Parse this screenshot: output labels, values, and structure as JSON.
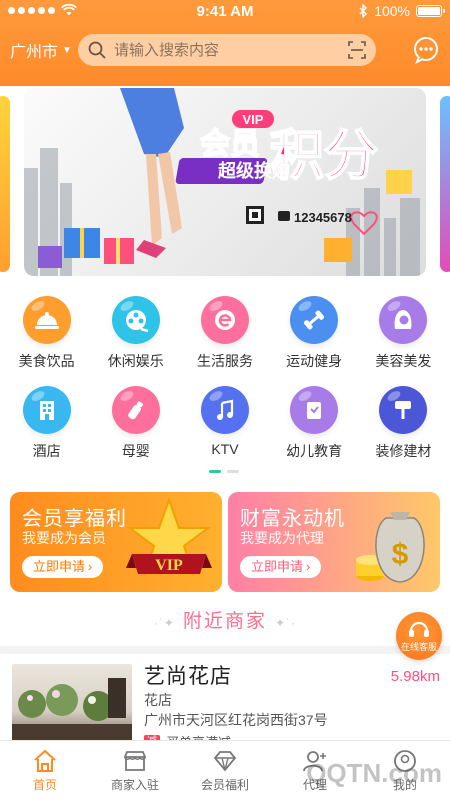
{
  "status_bar": {
    "time": "9:41 AM",
    "battery": "100%"
  },
  "header": {
    "city": "广州市",
    "search_placeholder": "请输入搜索内容"
  },
  "banner": {
    "vip_tag": "VIP",
    "title_left": "会员",
    "title_big": "积分",
    "subtitle": "超级换购",
    "phone": "12345678"
  },
  "categories": [
    {
      "label": "美食饮品",
      "color": "#ff9d2e",
      "icon": "food-cover-icon"
    },
    {
      "label": "休闲娱乐",
      "color": "#2fc3e8",
      "icon": "film-reel-icon"
    },
    {
      "label": "生活服务",
      "color": "#ff6f9d",
      "icon": "e-letter-icon"
    },
    {
      "label": "运动健身",
      "color": "#4b8ff0",
      "icon": "dumbbell-icon"
    },
    {
      "label": "美容美发",
      "color": "#a77be8",
      "icon": "woman-face-icon"
    },
    {
      "label": "酒店",
      "color": "#39b8f0",
      "icon": "hotel-building-icon"
    },
    {
      "label": "母婴",
      "color": "#ff6f9d",
      "icon": "baby-bottle-icon"
    },
    {
      "label": "KTV",
      "color": "#5571ef",
      "icon": "music-note-icon"
    },
    {
      "label": "幼儿教育",
      "color": "#a77be8",
      "icon": "book-icon"
    },
    {
      "label": "装修建材",
      "color": "#4c57d8",
      "icon": "paint-roller-icon"
    }
  ],
  "promos": {
    "vip": {
      "title": "会员享福利",
      "subtitle": "我要成为会员",
      "button": "立即申请",
      "badge": "VIP"
    },
    "agent": {
      "title": "财富永动机",
      "subtitle": "我要成为代理",
      "button": "立即申请",
      "badge": "$"
    }
  },
  "nearby_title": "附近商家",
  "kefu_label": "在线客服",
  "merchant": {
    "name": "艺尚花店",
    "distance": "5.98km",
    "category": "花店",
    "address": "广州市天河区红花岗西街37号",
    "promo": "买单享满减"
  },
  "tabbar": [
    {
      "label": "首页",
      "icon": "home-icon"
    },
    {
      "label": "商家入驻",
      "icon": "store-icon"
    },
    {
      "label": "会员福利",
      "icon": "diamond-icon"
    },
    {
      "label": "代理",
      "icon": "agent-user-icon"
    },
    {
      "label": "我的",
      "icon": "profile-icon"
    }
  ],
  "watermark": "QQTN.com"
}
